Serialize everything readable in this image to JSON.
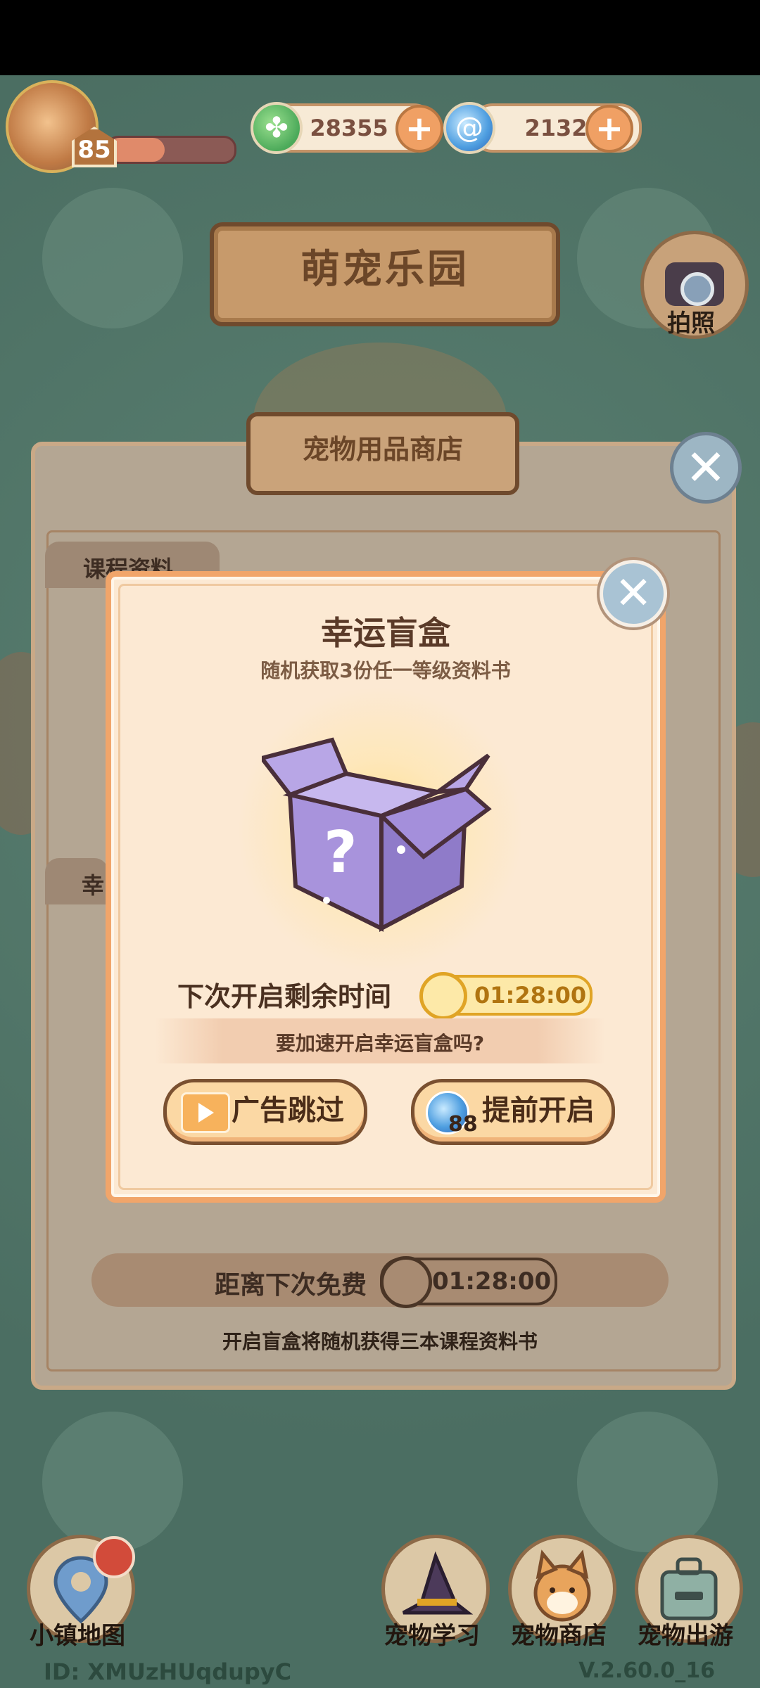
{
  "player": {
    "level": "85",
    "xp_progress": 0.45
  },
  "currencies": [
    {
      "name": "leaf-coin",
      "value": "28355"
    },
    {
      "name": "swirl-gem",
      "value": "2132"
    }
  ],
  "header": {
    "title": "萌宠乐园",
    "camera_label": "拍照"
  },
  "shop": {
    "title": "宠物用品商店",
    "tab1": "课程资料",
    "tab2": "幸",
    "free_label": "距离下次免费",
    "free_timer": "01:28:00",
    "description": "开启盲盒将随机获得三本课程资料书"
  },
  "dialog": {
    "title": "幸运盲盒",
    "subtitle": "随机获取3份任一等级资料书",
    "timer_label": "下次开启剩余时间",
    "timer_value": "01:28:00",
    "speed_prompt": "要加速开启幸运盲盒吗?",
    "ad_button": "广告跳过",
    "early_button": "提前开启",
    "early_cost": "88"
  },
  "nav": {
    "map": "小镇地图",
    "learn": "宠物学习",
    "shop": "宠物商店",
    "travel": "宠物出游"
  },
  "footer": {
    "id": "ID: XMUzHUqdupyC",
    "version": "V.2.60.0_16"
  },
  "colors": {
    "accent": "#f1a56a",
    "timer_gold": "#e0a425",
    "background": "#4f7467"
  }
}
